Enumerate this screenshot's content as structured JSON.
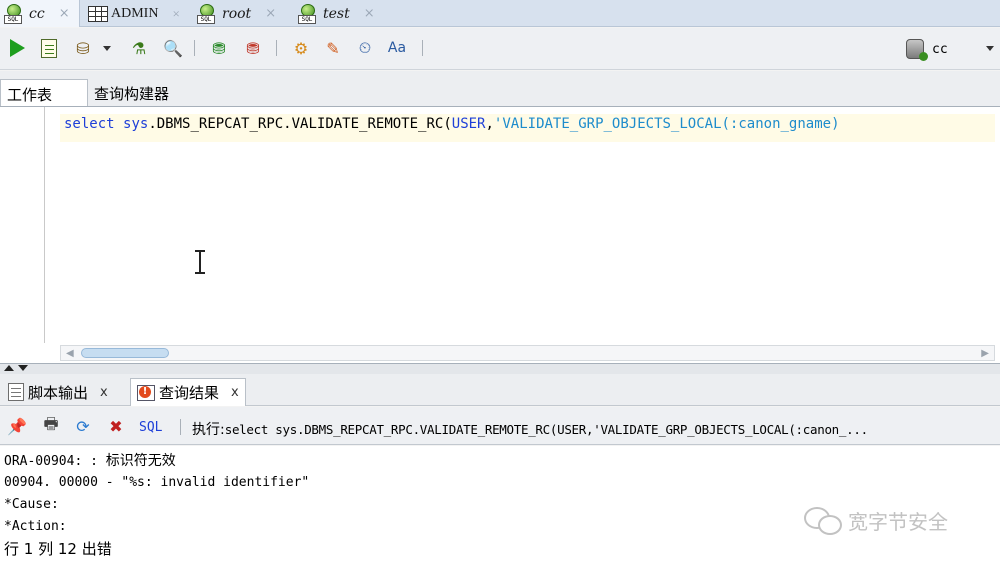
{
  "doc_tabs": [
    {
      "label": "cc",
      "active": true
    },
    {
      "label": "ADMIN",
      "active": false
    },
    {
      "label": "root",
      "active": false
    },
    {
      "label": "test",
      "active": false
    }
  ],
  "tab_close_glyph": "×",
  "connection": {
    "label": "cc"
  },
  "sub_tabs": {
    "worksheet": "工作表",
    "query_builder": "查询构建器"
  },
  "editor": {
    "kw_select": "select",
    "kw_sys": "sys",
    "dot": ".",
    "fn": "DBMS_REPCAT_RPC.VALIDATE_REMOTE_RC",
    "paren_open": "(",
    "kw_user": "USER",
    "comma": ",",
    "string_part": "'VALIDATE_GRP_OBJECTS_LOCAL(:canon_gname)"
  },
  "output_tabs": {
    "script_output": "脚本输出",
    "query_result": "查询结果",
    "close": "x"
  },
  "result_toolbar": {
    "sql_label": "SQL",
    "exec_label": "执行:",
    "exec_query": "select sys.DBMS_REPCAT_RPC.VALIDATE_REMOTE_RC(USER,'VALIDATE_GRP_OBJECTS_LOCAL(:canon_..."
  },
  "output_lines": [
    {
      "code": "ORA-00904: : ",
      "text": "标识符无效"
    },
    {
      "code": "00904. 00000 -  \"%s: invalid identifier\"",
      "text": ""
    },
    {
      "code": "*Cause:",
      "text": ""
    },
    {
      "code": "*Action:",
      "text": ""
    }
  ],
  "error_position": "行 1 列 12 出错",
  "watermark": "宽字节安全"
}
